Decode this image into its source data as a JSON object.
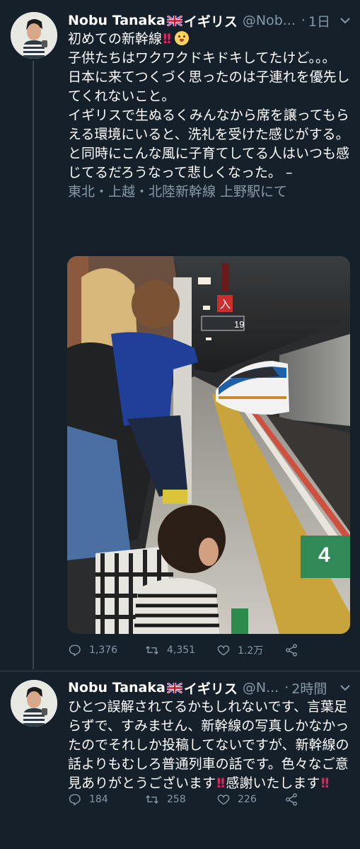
{
  "tweets": [
    {
      "name": "Nobu Tanaka",
      "name_suffix": "イギリス",
      "handle": "@Nob...",
      "time": "1日",
      "text_lines": [
        "初めての新幹線",
        "子供たちはワクワクドキドキしてたけど。。。",
        "日本に来てつくづく思ったのは子連れを優先してくれないこと。",
        "イギリスで生ぬるくみんなから席を譲ってもらえる環境にいると、洗礼を受けた感じがする。",
        "と同時にこんな風に子育てしてる人はいつも感じてるだろうなって悲しくなった。 –"
      ],
      "location": "東北・上越・北陸新幹線 上野駅にて",
      "photo": {
        "sign_platform": "19",
        "sign_number": "4",
        "sign_kanji_entrance": "入"
      },
      "replies": "1,376",
      "retweets": "4,351",
      "likes": "1.2万"
    },
    {
      "name": "Nobu Tanaka",
      "name_suffix": "イギリス",
      "handle": "@N...",
      "time": "2時間",
      "text_parts": {
        "main": "ひとつ誤解されてるかもしれないです、言葉足らずで、すみません、新幹線の写真しかなかったのでそれしか投稿してないですが、新幹線の話よりもむしろ普通列車の話です。色々なご意見ありがとうございます",
        "thanks": "感謝いたします"
      },
      "replies": "184",
      "retweets": "258",
      "likes": "226"
    }
  ],
  "colors": {
    "background": "#15202b",
    "secondary_text": "#8899a6",
    "divider": "#38444d",
    "emoji_red": "#e0245e"
  },
  "icons": {
    "reply": "reply-icon",
    "retweet": "retweet-icon",
    "like": "heart-icon",
    "share": "share-icon",
    "more": "chevron-down-icon"
  }
}
